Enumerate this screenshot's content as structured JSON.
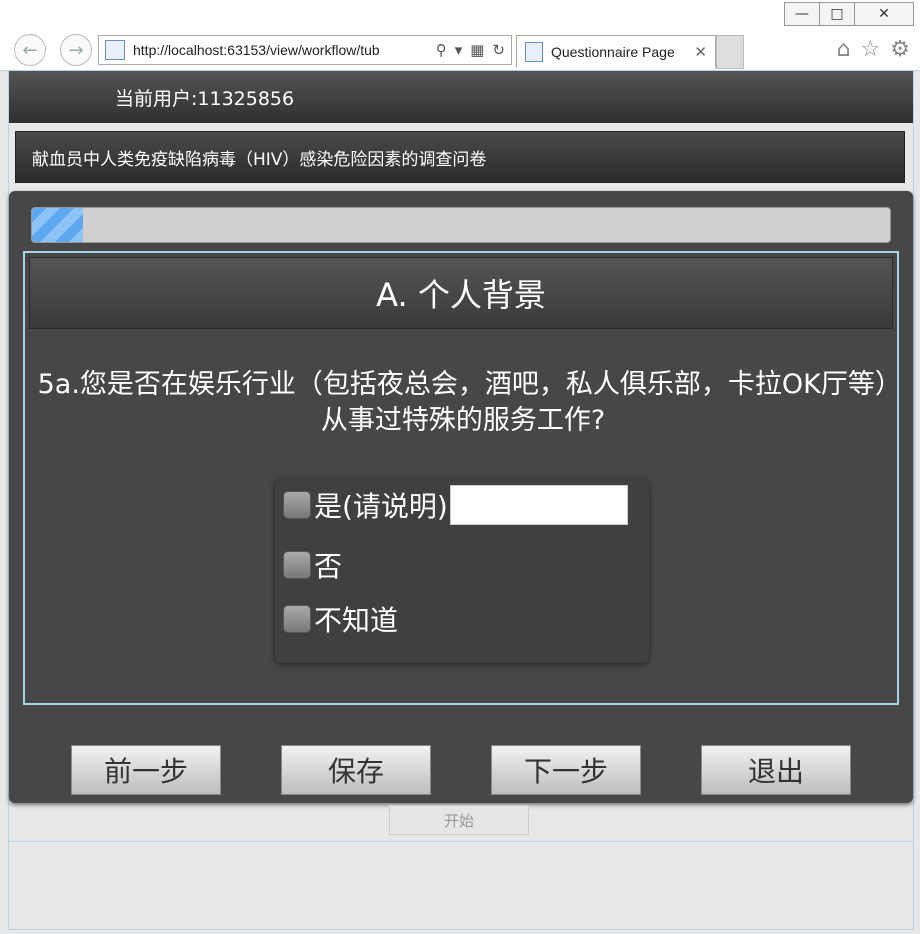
{
  "browser": {
    "url": "http://localhost:63153/view/workflow/tub",
    "tab_title": "Questionnaire Page"
  },
  "header": {
    "user_label": "当前用户:11325856",
    "survey_title": "献血员中人类免疫缺陷病毒（HIV）感染危险因素的调查问卷"
  },
  "progress": {
    "fraction": 0.06
  },
  "section": {
    "title": "A. 个人背景"
  },
  "question": {
    "text": "5a.您是否在娱乐行业（包括夜总会，酒吧，私人俱乐部，卡拉OK厅等）从事过特殊的服务工作?",
    "options": [
      {
        "label": "是(请说明)",
        "has_input": true,
        "input_value": ""
      },
      {
        "label": "否"
      },
      {
        "label": "不知道"
      }
    ]
  },
  "buttons": {
    "prev": "前一步",
    "save": "保存",
    "next": "下一步",
    "exit": "退出",
    "start": "开始"
  },
  "colors": {
    "panel_bg": "#474747",
    "frame_border": "#a6d4e6",
    "progress_fill": "#5fa8ef"
  }
}
